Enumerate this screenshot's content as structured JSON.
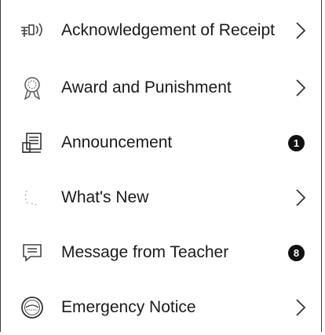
{
  "menu": {
    "items": [
      {
        "label": "Acknowledgement of Receipt",
        "icon": "megaphone-icon",
        "trailing": "chevron"
      },
      {
        "label": "Award and Punishment",
        "icon": "medal-icon",
        "trailing": "chevron"
      },
      {
        "label": "Announcement",
        "icon": "notice-board-icon",
        "trailing": "badge",
        "badge": "1"
      },
      {
        "label": "What's New",
        "icon": "news-icon",
        "trailing": "chevron"
      },
      {
        "label": "Message from Teacher",
        "icon": "message-icon",
        "trailing": "badge",
        "badge": "8"
      },
      {
        "label": "Emergency Notice",
        "icon": "emergency-stamp-icon",
        "trailing": "chevron"
      }
    ]
  },
  "colors": {
    "text": "#1a1a1a",
    "badge": "#111111",
    "border": "#3a3a3a"
  }
}
